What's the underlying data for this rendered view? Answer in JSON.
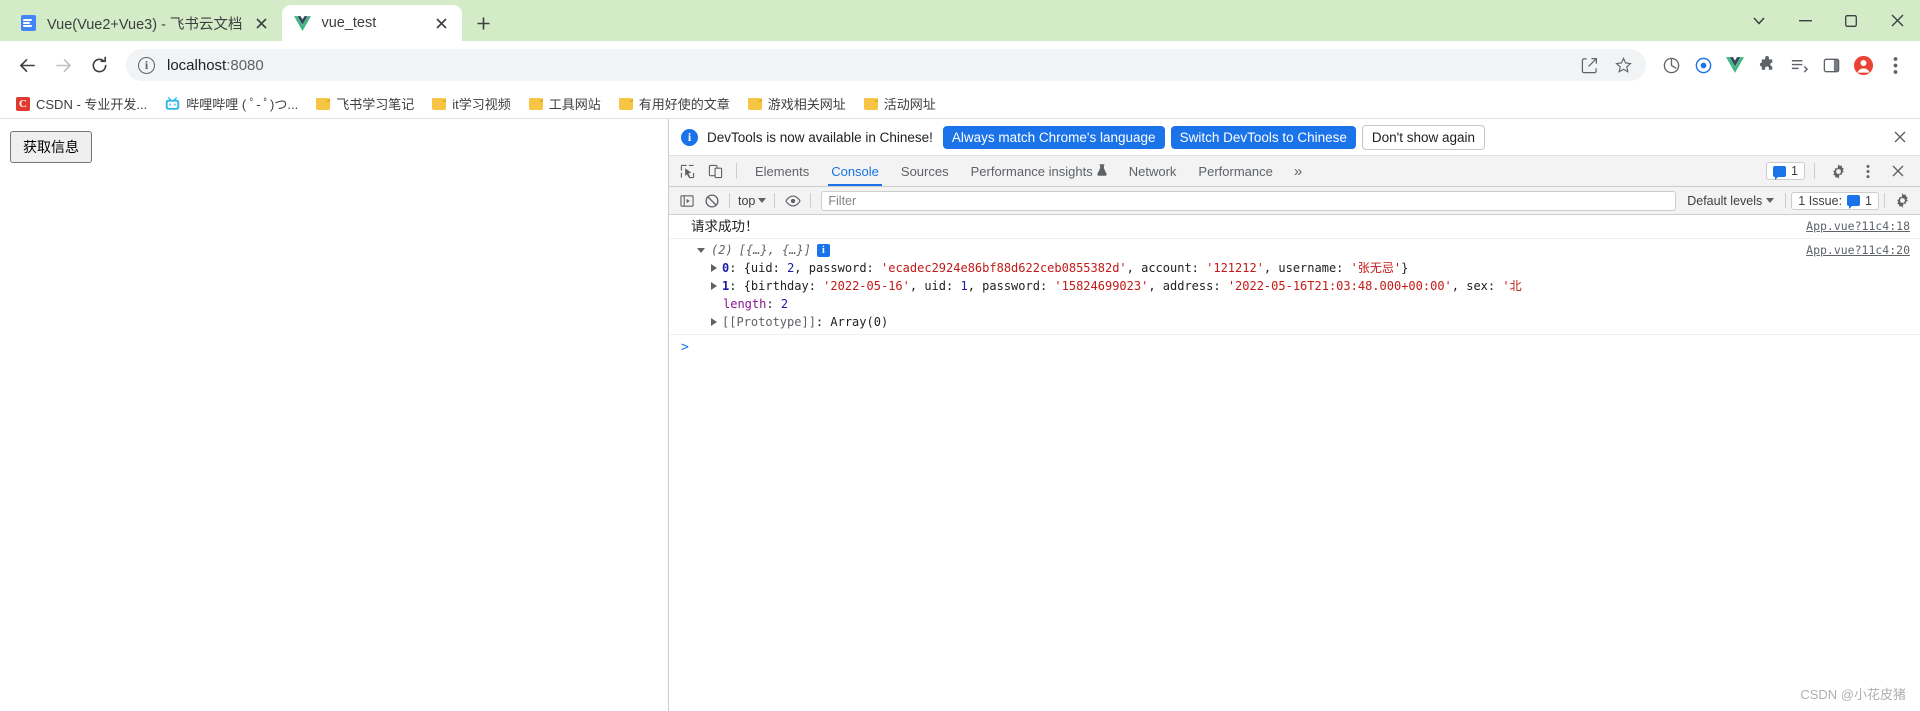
{
  "window": {
    "controls": {
      "minimize": "minimize-icon",
      "maximize": "maximize-icon",
      "close": "close-icon",
      "expand": "chevron-down-icon"
    }
  },
  "tabs": [
    {
      "title": "Vue(Vue2+Vue3) - 飞书云文档",
      "favicon": "doc-icon",
      "active": false
    },
    {
      "title": "vue_test",
      "favicon": "vue-icon",
      "active": true
    }
  ],
  "new_tab_label": "+",
  "toolbar": {
    "back": "←",
    "forward": "→",
    "reload": "⟳",
    "url_host": "localhost",
    "url_port": ":8080",
    "site_info": "ⓘ"
  },
  "bookmarks": [
    {
      "label": "CSDN - 专业开发...",
      "icon": "csdn-icon"
    },
    {
      "label": "哔哩哔哩 ( ﾟ- ﾟ)つ...",
      "icon": "bilibili-icon"
    },
    {
      "label": "飞书学习笔记",
      "icon": "folder-icon"
    },
    {
      "label": "it学习视频",
      "icon": "folder-icon"
    },
    {
      "label": "工具网站",
      "icon": "folder-icon"
    },
    {
      "label": "有用好使的文章",
      "icon": "folder-icon"
    },
    {
      "label": "游戏相关网址",
      "icon": "folder-icon"
    },
    {
      "label": "活动网址",
      "icon": "folder-icon"
    }
  ],
  "page": {
    "button_label": "获取信息"
  },
  "devtools": {
    "notification": {
      "message": "DevTools is now available in Chinese!",
      "primary_button": "Always match Chrome's language",
      "secondary_button": "Switch DevTools to Chinese",
      "dismiss_button": "Don't show again",
      "close": "×"
    },
    "panels": [
      {
        "label": "Elements",
        "selected": false
      },
      {
        "label": "Console",
        "selected": true
      },
      {
        "label": "Sources",
        "selected": false
      },
      {
        "label": "Performance insights",
        "selected": false,
        "badge": "experiment-icon"
      },
      {
        "label": "Network",
        "selected": false
      },
      {
        "label": "Performance",
        "selected": false
      }
    ],
    "more_panels": "»",
    "messages_count": "1",
    "settings_icon": "gear-icon",
    "kebab_icon": "more-vertical-icon",
    "close_icon": "close-icon",
    "filterbar": {
      "sidebar_toggle": "console-sidebar-icon",
      "clear": "clear-console-icon",
      "context": "top",
      "eye": "live-expression-icon",
      "filter_placeholder": "Filter",
      "filter_value": "",
      "levels": "Default levels",
      "issues": "1 Issue:",
      "issues_count": "1",
      "settings": "gear-icon"
    }
  },
  "console": {
    "entries": [
      {
        "type": "text",
        "text": "请求成功！",
        "source": "App.vue?11c4:18"
      },
      {
        "type": "array",
        "header_count": "(2)",
        "header_preview": "[{…}, {…}]",
        "info_badge": "i",
        "source": "App.vue?11c4:20",
        "items": [
          {
            "index": "0",
            "parts": [
              {
                "t": "{",
                "c": "plain"
              },
              {
                "t": "uid",
                "c": "keyd"
              },
              {
                "t": ": ",
                "c": "plain"
              },
              {
                "t": "2",
                "c": "num"
              },
              {
                "t": ", ",
                "c": "plain"
              },
              {
                "t": "password",
                "c": "keyd"
              },
              {
                "t": ": ",
                "c": "plain"
              },
              {
                "t": "'ecadec2924e86bf88d622ceb0855382d'",
                "c": "str"
              },
              {
                "t": ", ",
                "c": "plain"
              },
              {
                "t": "account",
                "c": "keyd"
              },
              {
                "t": ": ",
                "c": "plain"
              },
              {
                "t": "'121212'",
                "c": "str"
              },
              {
                "t": ", ",
                "c": "plain"
              },
              {
                "t": "username",
                "c": "keyd"
              },
              {
                "t": ": ",
                "c": "plain"
              },
              {
                "t": "'张无忌'",
                "c": "str"
              },
              {
                "t": "}",
                "c": "plain"
              }
            ]
          },
          {
            "index": "1",
            "parts": [
              {
                "t": "{",
                "c": "plain"
              },
              {
                "t": "birthday",
                "c": "keyd"
              },
              {
                "t": ": ",
                "c": "plain"
              },
              {
                "t": "'2022-05-16'",
                "c": "str"
              },
              {
                "t": ", ",
                "c": "plain"
              },
              {
                "t": "uid",
                "c": "keyd"
              },
              {
                "t": ": ",
                "c": "plain"
              },
              {
                "t": "1",
                "c": "num"
              },
              {
                "t": ", ",
                "c": "plain"
              },
              {
                "t": "password",
                "c": "keyd"
              },
              {
                "t": ": ",
                "c": "plain"
              },
              {
                "t": "'15824699023'",
                "c": "str"
              },
              {
                "t": ", ",
                "c": "plain"
              },
              {
                "t": "address",
                "c": "keyd"
              },
              {
                "t": ": ",
                "c": "plain"
              },
              {
                "t": "'2022-05-16T21:03:48.000+00:00'",
                "c": "str"
              },
              {
                "t": ", ",
                "c": "plain"
              },
              {
                "t": "sex",
                "c": "keyd"
              },
              {
                "t": ": ",
                "c": "plain"
              },
              {
                "t": "'北",
                "c": "str"
              }
            ]
          }
        ],
        "length_key": "length",
        "length_value": "2",
        "prototype_key": "[[Prototype]]",
        "prototype_value": "Array(0)"
      }
    ],
    "prompt": ">"
  },
  "watermark": "CSDN @小花皮猪"
}
